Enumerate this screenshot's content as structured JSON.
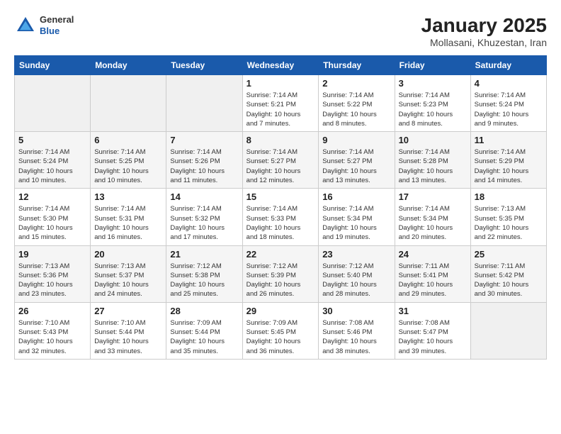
{
  "header": {
    "logo_general": "General",
    "logo_blue": "Blue",
    "month_title": "January 2025",
    "location": "Mollasani, Khuzestan, Iran"
  },
  "weekdays": [
    "Sunday",
    "Monday",
    "Tuesday",
    "Wednesday",
    "Thursday",
    "Friday",
    "Saturday"
  ],
  "weeks": [
    [
      {
        "day": "",
        "info": ""
      },
      {
        "day": "",
        "info": ""
      },
      {
        "day": "",
        "info": ""
      },
      {
        "day": "1",
        "info": "Sunrise: 7:14 AM\nSunset: 5:21 PM\nDaylight: 10 hours\nand 7 minutes."
      },
      {
        "day": "2",
        "info": "Sunrise: 7:14 AM\nSunset: 5:22 PM\nDaylight: 10 hours\nand 8 minutes."
      },
      {
        "day": "3",
        "info": "Sunrise: 7:14 AM\nSunset: 5:23 PM\nDaylight: 10 hours\nand 8 minutes."
      },
      {
        "day": "4",
        "info": "Sunrise: 7:14 AM\nSunset: 5:24 PM\nDaylight: 10 hours\nand 9 minutes."
      }
    ],
    [
      {
        "day": "5",
        "info": "Sunrise: 7:14 AM\nSunset: 5:24 PM\nDaylight: 10 hours\nand 10 minutes."
      },
      {
        "day": "6",
        "info": "Sunrise: 7:14 AM\nSunset: 5:25 PM\nDaylight: 10 hours\nand 10 minutes."
      },
      {
        "day": "7",
        "info": "Sunrise: 7:14 AM\nSunset: 5:26 PM\nDaylight: 10 hours\nand 11 minutes."
      },
      {
        "day": "8",
        "info": "Sunrise: 7:14 AM\nSunset: 5:27 PM\nDaylight: 10 hours\nand 12 minutes."
      },
      {
        "day": "9",
        "info": "Sunrise: 7:14 AM\nSunset: 5:27 PM\nDaylight: 10 hours\nand 13 minutes."
      },
      {
        "day": "10",
        "info": "Sunrise: 7:14 AM\nSunset: 5:28 PM\nDaylight: 10 hours\nand 13 minutes."
      },
      {
        "day": "11",
        "info": "Sunrise: 7:14 AM\nSunset: 5:29 PM\nDaylight: 10 hours\nand 14 minutes."
      }
    ],
    [
      {
        "day": "12",
        "info": "Sunrise: 7:14 AM\nSunset: 5:30 PM\nDaylight: 10 hours\nand 15 minutes."
      },
      {
        "day": "13",
        "info": "Sunrise: 7:14 AM\nSunset: 5:31 PM\nDaylight: 10 hours\nand 16 minutes."
      },
      {
        "day": "14",
        "info": "Sunrise: 7:14 AM\nSunset: 5:32 PM\nDaylight: 10 hours\nand 17 minutes."
      },
      {
        "day": "15",
        "info": "Sunrise: 7:14 AM\nSunset: 5:33 PM\nDaylight: 10 hours\nand 18 minutes."
      },
      {
        "day": "16",
        "info": "Sunrise: 7:14 AM\nSunset: 5:34 PM\nDaylight: 10 hours\nand 19 minutes."
      },
      {
        "day": "17",
        "info": "Sunrise: 7:14 AM\nSunset: 5:34 PM\nDaylight: 10 hours\nand 20 minutes."
      },
      {
        "day": "18",
        "info": "Sunrise: 7:13 AM\nSunset: 5:35 PM\nDaylight: 10 hours\nand 22 minutes."
      }
    ],
    [
      {
        "day": "19",
        "info": "Sunrise: 7:13 AM\nSunset: 5:36 PM\nDaylight: 10 hours\nand 23 minutes."
      },
      {
        "day": "20",
        "info": "Sunrise: 7:13 AM\nSunset: 5:37 PM\nDaylight: 10 hours\nand 24 minutes."
      },
      {
        "day": "21",
        "info": "Sunrise: 7:12 AM\nSunset: 5:38 PM\nDaylight: 10 hours\nand 25 minutes."
      },
      {
        "day": "22",
        "info": "Sunrise: 7:12 AM\nSunset: 5:39 PM\nDaylight: 10 hours\nand 26 minutes."
      },
      {
        "day": "23",
        "info": "Sunrise: 7:12 AM\nSunset: 5:40 PM\nDaylight: 10 hours\nand 28 minutes."
      },
      {
        "day": "24",
        "info": "Sunrise: 7:11 AM\nSunset: 5:41 PM\nDaylight: 10 hours\nand 29 minutes."
      },
      {
        "day": "25",
        "info": "Sunrise: 7:11 AM\nSunset: 5:42 PM\nDaylight: 10 hours\nand 30 minutes."
      }
    ],
    [
      {
        "day": "26",
        "info": "Sunrise: 7:10 AM\nSunset: 5:43 PM\nDaylight: 10 hours\nand 32 minutes."
      },
      {
        "day": "27",
        "info": "Sunrise: 7:10 AM\nSunset: 5:44 PM\nDaylight: 10 hours\nand 33 minutes."
      },
      {
        "day": "28",
        "info": "Sunrise: 7:09 AM\nSunset: 5:44 PM\nDaylight: 10 hours\nand 35 minutes."
      },
      {
        "day": "29",
        "info": "Sunrise: 7:09 AM\nSunset: 5:45 PM\nDaylight: 10 hours\nand 36 minutes."
      },
      {
        "day": "30",
        "info": "Sunrise: 7:08 AM\nSunset: 5:46 PM\nDaylight: 10 hours\nand 38 minutes."
      },
      {
        "day": "31",
        "info": "Sunrise: 7:08 AM\nSunset: 5:47 PM\nDaylight: 10 hours\nand 39 minutes."
      },
      {
        "day": "",
        "info": ""
      }
    ]
  ]
}
